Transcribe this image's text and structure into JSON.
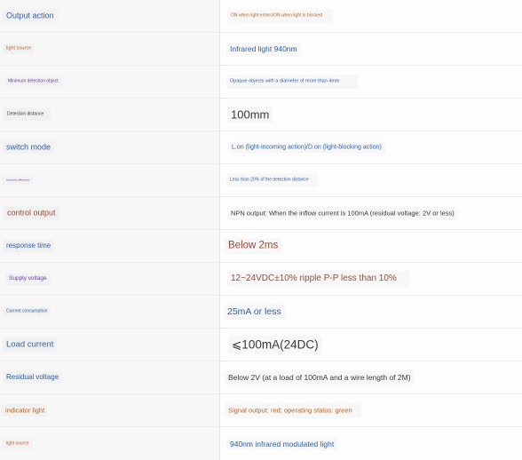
{
  "colors": {
    "blue": "#2f5fa8",
    "orange": "#b5652b",
    "purple": "#6b3fa0",
    "dark": "#3a3a3a",
    "brown": "#9a4a35"
  },
  "rows": [
    {
      "label": "Output action",
      "value": "ON when light enters/ON when light is blocked"
    },
    {
      "label": "light source",
      "value": "Infrared light 940nm"
    },
    {
      "label": "Minimum detection object",
      "value": "Opaque objects with a diameter of more than 4mm"
    },
    {
      "label": "Detection distance",
      "value": "100mm"
    },
    {
      "label": "switch mode",
      "value": "L.on (light-incoming action)/D.on (light-blocking action)"
    },
    {
      "label": "response difference",
      "value": "Less than 20% of the detection distance"
    },
    {
      "label": "control output",
      "value": "NPN output: When the inflow current is 100mA (residual voltage: 2V or less)"
    },
    {
      "label": "response time",
      "value": "Below 2ms"
    },
    {
      "label": "Supply voltage",
      "value": "12~24VDC±10% ripple P-P less than 10%"
    },
    {
      "label": "Current consumption",
      "value": "25mA or less"
    },
    {
      "label": "Load current",
      "value": "⩽100mA(24DC)"
    },
    {
      "label": "Residual voltage",
      "value": "Below 2V (at a load of 100mA and a wire length of 2M)"
    },
    {
      "label": "indicator light",
      "value": "Signal output: red; operating status: green"
    },
    {
      "label": "light source",
      "value": "940nm infrared modulated light"
    }
  ]
}
